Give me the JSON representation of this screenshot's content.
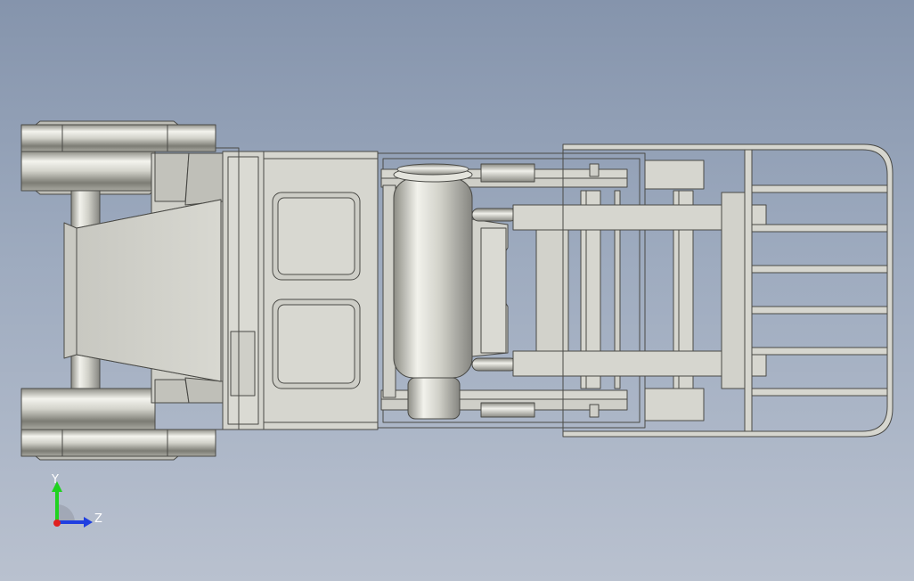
{
  "viewport": {
    "background_top": "#8594ac",
    "background_bottom": "#b9c1cf",
    "model_fill": "#d6d6cf",
    "model_edge": "#4a4a46"
  },
  "triad": {
    "y_label": "Y",
    "z_label": "Z",
    "y_color": "#1fd21f",
    "z_color": "#1f3fe0",
    "x_color": "#e02020"
  }
}
